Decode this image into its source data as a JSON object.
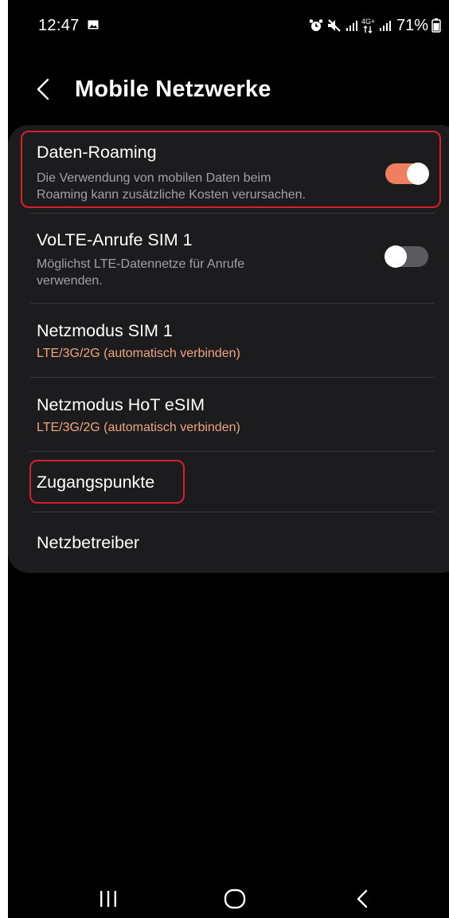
{
  "status_bar": {
    "time": "12:47",
    "network_badge": "4G+",
    "battery": "71%",
    "icons": [
      "gallery-icon",
      "alarm-icon",
      "mute-icon",
      "signal-icon",
      "signal-icon",
      "battery-icon"
    ]
  },
  "header": {
    "title": "Mobile Netzwerke",
    "back_icon": "chevron-left-icon"
  },
  "settings": {
    "data_roaming": {
      "title": "Daten-Roaming",
      "subtitle_line1": "Die Verwendung von mobilen Daten beim",
      "subtitle_line2": "Roaming kann zusätzliche Kosten verursachen.",
      "enabled": true
    },
    "volte": {
      "title": "VoLTE-Anrufe SIM 1",
      "subtitle_line1": "Möglichst LTE-Datennetze für Anrufe",
      "subtitle_line2": "verwenden.",
      "enabled": false
    },
    "network_mode_sim1": {
      "title": "Netzmodus SIM 1",
      "subtitle": "LTE/3G/2G (automatisch verbinden)"
    },
    "network_mode_esim": {
      "title": "Netzmodus HoT eSIM",
      "subtitle": "LTE/3G/2G (automatisch verbinden)"
    },
    "access_points": {
      "title": "Zugangspunkte"
    },
    "network_operators": {
      "title": "Netzbetreiber"
    }
  },
  "nav_bar": {
    "icons": [
      "recent-apps-icon",
      "home-icon",
      "back-icon"
    ]
  },
  "colors": {
    "background": "#000000",
    "card": "#1c1c1e",
    "accent": "#ef7f5e",
    "subtitle_accent": "#f0a57e",
    "highlight": "#d8202a"
  }
}
